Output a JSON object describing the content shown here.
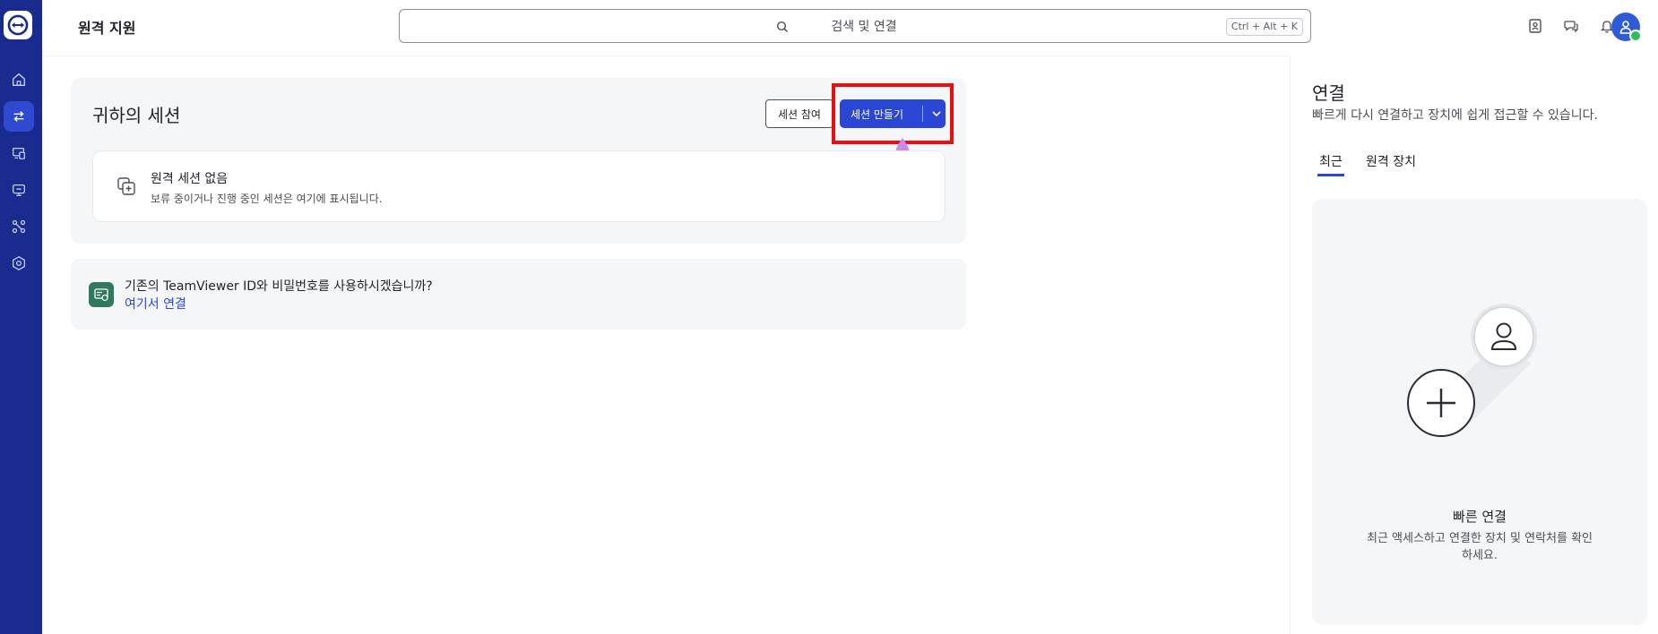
{
  "header": {
    "title": "원격 지원",
    "search": {
      "placeholder": "검색 및 연결",
      "shortcut": "Ctrl + Alt + K"
    }
  },
  "nav": {
    "items": [
      {
        "icon": "home-icon"
      },
      {
        "icon": "remote-swap-icon",
        "active": true
      },
      {
        "icon": "devices-icon"
      },
      {
        "icon": "sessions-icon"
      },
      {
        "icon": "integrations-icon"
      },
      {
        "icon": "settings-icon"
      }
    ]
  },
  "sessions": {
    "title": "귀하의 세션",
    "join_label": "세션 참여",
    "create_label": "세션 만들기",
    "empty_title": "원격 세션 없음",
    "empty_desc": "보류 중이거나 진행 중인 세션은 여기에 표시됩니다."
  },
  "legacy": {
    "text": "기존의 TeamViewer ID와 비밀번호를 사용하시겠습니까?",
    "link": "여기서 연결"
  },
  "connections": {
    "title": "연결",
    "subtitle": "빠르게 다시 연결하고 장치에 쉽게 접근할 수 있습니다.",
    "tabs": [
      "최근",
      "원격 장치"
    ],
    "quick_connect": {
      "title": "빠른 연결",
      "desc": "최근 액세스하고 연결한 장치 및 연락처를 확인하세요."
    }
  },
  "colors": {
    "rail": "#1a2b8f",
    "accent": "#2b45d4",
    "highlight": "#ee0d0d"
  }
}
